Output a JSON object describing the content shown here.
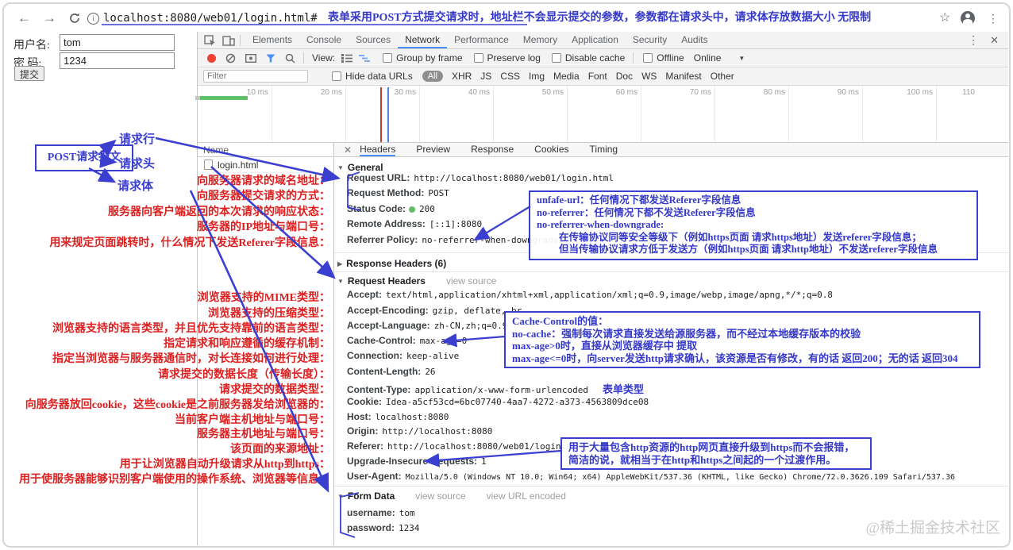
{
  "browser": {
    "url": "localhost:8080/web01/login.html#",
    "annotation": "表单采用POST方式提交请求时，地址栏不会显示提交的参数，参数都在请求头中，请求体存放数据大小 无限制"
  },
  "page_form": {
    "username_label": "用户名:",
    "username_value": "tom",
    "password_label": "密  码:",
    "password_value": "1234",
    "submit_label": "提交"
  },
  "dt": {
    "tabs": [
      "Elements",
      "Console",
      "Sources",
      "Network",
      "Performance",
      "Memory",
      "Application",
      "Security",
      "Audits"
    ],
    "active_tab": "Network",
    "toolbar": {
      "view_label": "View:",
      "group_by_frame": "Group by frame",
      "preserve_log": "Preserve log",
      "disable_cache": "Disable cache",
      "offline": "Offline",
      "online": "Online"
    },
    "filter": {
      "placeholder": "Filter",
      "hide_data_urls": "Hide data URLs",
      "types": [
        "All",
        "XHR",
        "JS",
        "CSS",
        "Img",
        "Media",
        "Font",
        "Doc",
        "WS",
        "Manifest",
        "Other"
      ],
      "active_type": "All"
    },
    "timeline_ticks": [
      "10 ms",
      "20 ms",
      "30 ms",
      "40 ms",
      "50 ms",
      "60 ms",
      "70 ms",
      "80 ms",
      "90 ms",
      "100 ms",
      "110"
    ],
    "name_column": {
      "header": "Name",
      "rows": [
        "login.html"
      ]
    },
    "detail_tabs": [
      "Headers",
      "Preview",
      "Response",
      "Cookies",
      "Timing"
    ],
    "active_detail_tab": "Headers",
    "sections": {
      "general": {
        "title": "General",
        "rows": [
          {
            "name": "Request URL:",
            "value": "http://localhost:8080/web01/login.html"
          },
          {
            "name": "Request Method:",
            "value": "POST"
          },
          {
            "name": "Status Code:",
            "value": "200"
          },
          {
            "name": "Remote Address:",
            "value": "[::1]:8080"
          },
          {
            "name": "Referrer Policy:",
            "value": "no-referrer-when-downgrade"
          }
        ]
      },
      "response_headers": {
        "title": "Response Headers (6)"
      },
      "request_headers": {
        "title": "Request Headers",
        "view_source": "view source",
        "rows": [
          {
            "name": "Accept:",
            "value": "text/html,application/xhtml+xml,application/xml;q=0.9,image/webp,image/apng,*/*;q=0.8"
          },
          {
            "name": "Accept-Encoding:",
            "value": "gzip, deflate, br"
          },
          {
            "name": "Accept-Language:",
            "value": "zh-CN,zh;q=0.9"
          },
          {
            "name": "Cache-Control:",
            "value": "max-age=0"
          },
          {
            "name": "Connection:",
            "value": "keep-alive"
          },
          {
            "name": "Content-Length:",
            "value": "26"
          },
          {
            "name": "Content-Type:",
            "value": "application/x-www-form-urlencoded",
            "annotation": "表单类型"
          },
          {
            "name": "Cookie:",
            "value": "Idea-a5cf53cd=6bc07740-4aa7-4272-a373-4563809dce08"
          },
          {
            "name": "Host:",
            "value": "localhost:8080"
          },
          {
            "name": "Origin:",
            "value": "http://localhost:8080"
          },
          {
            "name": "Referer:",
            "value": "http://localhost:8080/web01/login.html"
          },
          {
            "name": "Upgrade-Insecure-Requests:",
            "value": "1"
          },
          {
            "name": "User-Agent:",
            "value": "Mozilla/5.0 (Windows NT 10.0; Win64; x64) AppleWebKit/537.36 (KHTML, like Gecko) Chrome/72.0.3626.109 Safari/537.36"
          }
        ]
      },
      "form_data": {
        "title": "Form Data",
        "view_source": "view source",
        "view_url_encoded": "view URL encoded",
        "rows": [
          {
            "name": "username:",
            "value": "tom"
          },
          {
            "name": "password:",
            "value": "1234"
          }
        ]
      }
    }
  },
  "annotations": {
    "diagram": {
      "box": "POST请求报文",
      "branches": [
        "请求行",
        "请求头",
        "请求体"
      ]
    },
    "red_lines": [
      "向服务器请求的域名地址：",
      "向服务器提交请求的方式：",
      "服务器向客户端返回的本次请求的响应状态：",
      "服务器的IP地址与端口号：",
      "用来规定页面跳转时，什么情况下发送Referer字段信息：",
      "浏览器支持的MIME类型：",
      "浏览器支持的压缩类型：",
      "浏览器支持的语言类型，并且优先支持靠前的语言类型：",
      "指定请求和响应遵循的缓存机制：",
      "指定当浏览器与服务器通信时，对长连接如何进行处理：",
      "请求提交的数据长度（传输长度）：",
      "请求提交的数据类型：",
      "向服务器放回cookie，这些cookie是之前服务器发给浏览器的：",
      "当前客户端主机地址与端口号：",
      "服务器主机地址与端口号：",
      "该页面的来源地址：",
      "用于让浏览器自动升级请求从http到https：",
      "用于使服务器能够识别客户端使用的操作系统、浏览器等信息："
    ],
    "blue_boxes": {
      "referrer": [
        "unfafe-url：任何情况下都发送Referer字段信息",
        "no-referrer：任何情况下都不发送Referer字段信息",
        "no-referrer-when-downgrade:",
        "在传输协议同等安全等级下（例如https页面 请求https地址）发送referer字段信息；",
        "但当传输协议请求方低于发送方（例如https页面 请求http地址）不发送referer字段信息"
      ],
      "cache": [
        "Cache-Control的值：",
        "no-cache：强制每次请求直接发送给源服务器，而不经过本地缓存版本的校验",
        "max-age>0时，直接从浏览器缓存中 提取",
        "max-age<=0时，向server发送http请求确认，该资源是否有修改，有的话 返回200；无的话 返回304"
      ],
      "upgrade": [
        "用于大量包含http资源的http网页直接升级到https而不会报错，",
        "简洁的说，就相当于在http和https之间起的一个过渡作用。"
      ]
    }
  },
  "watermark": "@稀土掘金技术社区",
  "colors": {
    "red_annotation": "#dd1f1f",
    "blue_annotation": "#3b3fd0",
    "devtools_accent": "#4a90f5",
    "status_green": "#66bb6a",
    "record_red": "#ee4237"
  }
}
